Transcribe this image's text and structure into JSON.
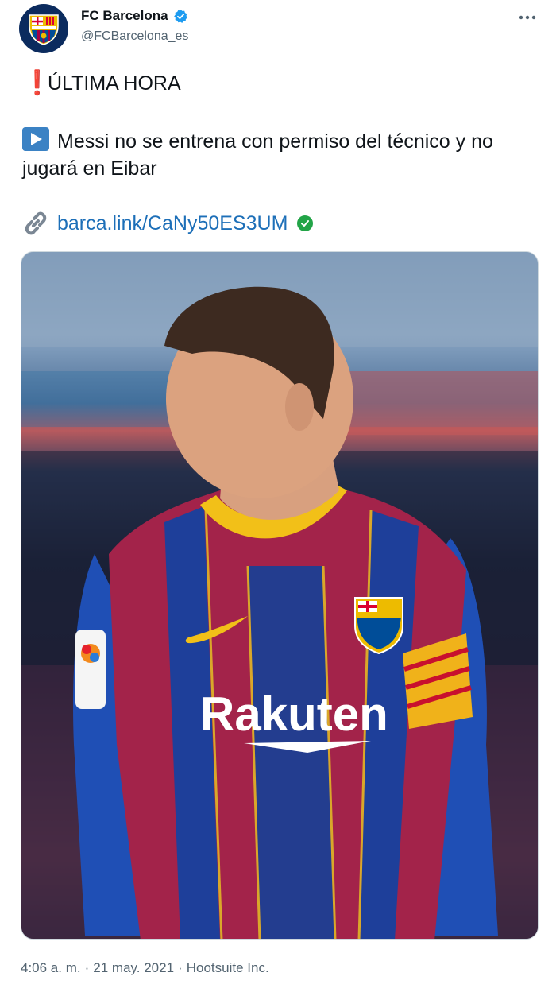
{
  "account": {
    "display_name": "FC Barcelona",
    "handle": "@FCBarcelona_es",
    "verified": true,
    "avatar_icon": "fc-barcelona-crest-icon"
  },
  "tweet": {
    "line1_emoji": "❗",
    "line1_text": "ÚLTIMA HORA",
    "line2_emoji": "▶️",
    "line2_text": "Messi no se entrena con permiso del técnico y no jugará en Eibar",
    "link_emoji": "🔗",
    "link_text": "barca.link/CaNy50ES3UM",
    "link_badge": "✅"
  },
  "media": {
    "description_icon": "player-photo",
    "jersey_sponsor": "Rakuten",
    "sleeve_badge": "Liga"
  },
  "footer": {
    "time": "4:06 a. m.",
    "separator1": "·",
    "date": "21 may. 2021",
    "separator2": "·",
    "source": "Hootsuite Inc."
  },
  "colors": {
    "link": "#1d6fb8",
    "verified": "#1d9bf0",
    "exclaim": "#d81b3c",
    "meta": "#536471"
  }
}
